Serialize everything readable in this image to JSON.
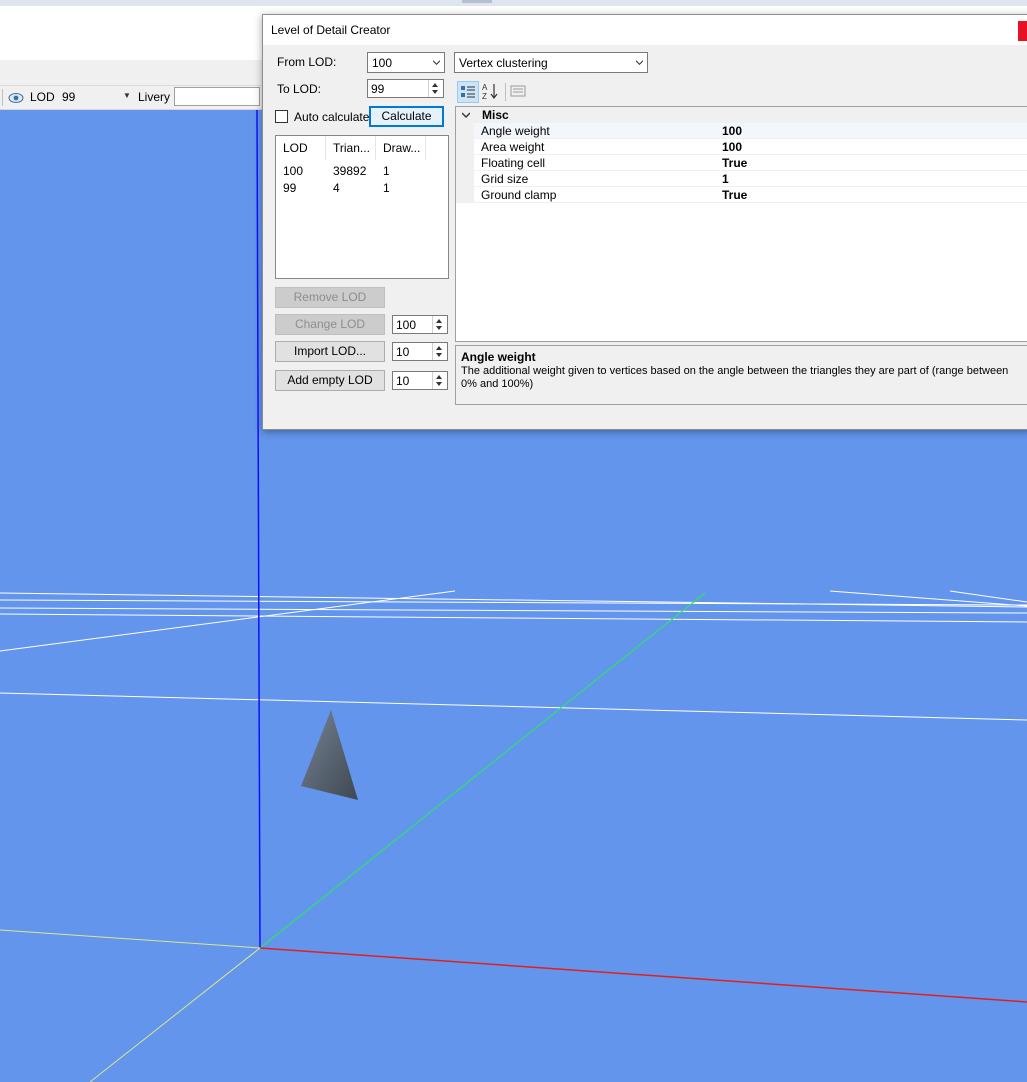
{
  "toolbar": {
    "lod_label": "LOD",
    "lod_value": "99",
    "livery_label": "Livery",
    "livery_value": ""
  },
  "dialog": {
    "title": "Level of Detail Creator",
    "from_lod_label": "From LOD:",
    "from_lod_value": "100",
    "to_lod_label": "To LOD:",
    "to_lod_value": "99",
    "algorithm": "Vertex clustering",
    "auto_calculate_label": "Auto calculate",
    "auto_calculate_checked": false,
    "calculate_label": "Calculate",
    "lod_table": {
      "headers": [
        "LOD",
        "Trian...",
        "Draw..."
      ],
      "rows": [
        [
          "100",
          "39892",
          "1"
        ],
        [
          "99",
          "4",
          "1"
        ]
      ]
    },
    "remove_lod_label": "Remove LOD",
    "change_lod_label": "Change LOD",
    "change_lod_value": "100",
    "import_lod_label": "Import LOD...",
    "import_lod_value": "10",
    "add_empty_lod_label": "Add empty LOD",
    "add_empty_lod_value": "10",
    "property_grid": {
      "category": "Misc",
      "properties": [
        {
          "name": "Angle weight",
          "value": "100"
        },
        {
          "name": "Area weight",
          "value": "100"
        },
        {
          "name": "Floating cell",
          "value": "True"
        },
        {
          "name": "Grid size",
          "value": "1"
        },
        {
          "name": "Ground clamp",
          "value": "True"
        }
      ],
      "help_title": "Angle weight",
      "help_text": "The additional weight given to vertices based on the angle between the triangles they are part of (range between 0% and 100%)"
    }
  },
  "colors": {
    "viewport_background": "#6495ed",
    "axis_x": "#e0201a",
    "axis_y": "#2ee06a",
    "axis_z": "#1010ff",
    "grid_lines": "#ffffff",
    "accent": "#0078d7"
  }
}
